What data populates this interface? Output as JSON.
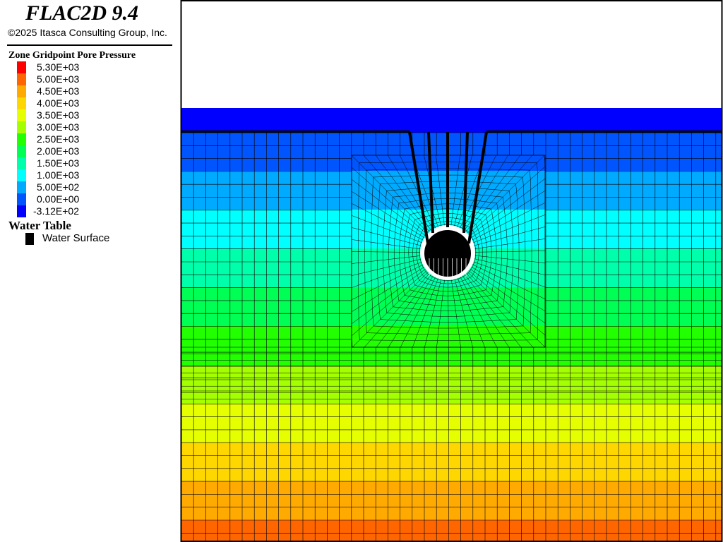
{
  "app": {
    "title": "FLAC2D 9.4",
    "copyright": "©2025 Itasca Consulting Group, Inc."
  },
  "legend": {
    "heading": "Zone Gridpoint Pore Pressure",
    "entries": [
      {
        "label": "5.30E+03",
        "color": "#ff0000"
      },
      {
        "label": "5.00E+03",
        "color": "#ff6600"
      },
      {
        "label": "4.50E+03",
        "color": "#ffaa00"
      },
      {
        "label": "4.00E+03",
        "color": "#ffd700"
      },
      {
        "label": "3.50E+03",
        "color": "#e5ff00"
      },
      {
        "label": "3.00E+03",
        "color": "#a4ff00"
      },
      {
        "label": "2.50E+03",
        "color": "#22ff00"
      },
      {
        "label": "2.00E+03",
        "color": "#00ff55"
      },
      {
        "label": "1.50E+03",
        "color": "#00ffaa"
      },
      {
        "label": "1.00E+03",
        "color": "#00ffff"
      },
      {
        "label": "5.00E+02",
        "color": "#00aaff"
      },
      {
        "label": "0.00E+00",
        "color": "#0055ff"
      },
      {
        "label": "-3.12E+02",
        "color": "#0000ff"
      }
    ]
  },
  "water_table": {
    "heading": "Water Table",
    "item_label": "Water Surface",
    "color": "#000000"
  },
  "plot": {
    "bands_top_to_bottom": [
      "#0000ff",
      "#0055ff",
      "#00aaff",
      "#00ffff",
      "#00ffaa",
      "#00ff55",
      "#22ff00",
      "#a4ff00",
      "#e5ff00",
      "#ffd700",
      "#ffaa00",
      "#ff6600",
      "#ff0000"
    ],
    "grid_color": "#000000",
    "tunnel_color": "#000000",
    "tunnel_rim_color": "#ffffff"
  }
}
